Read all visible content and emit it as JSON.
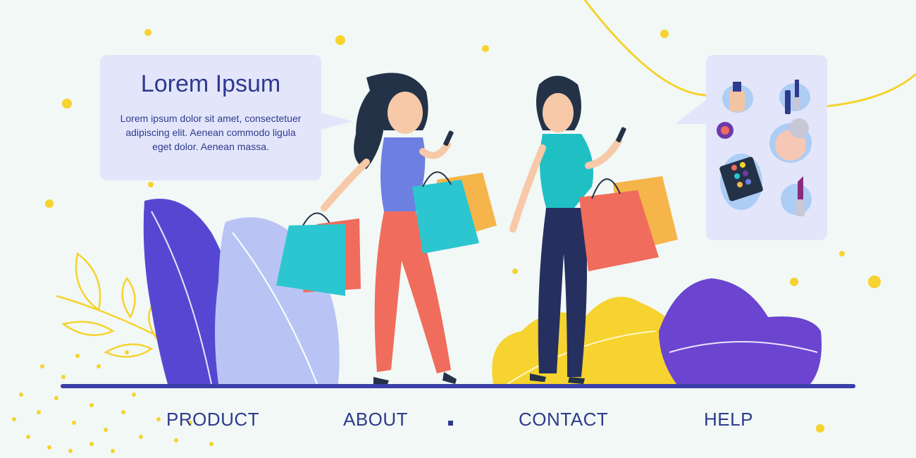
{
  "hero": {
    "title": "Lorem Ipsum",
    "body": "Lorem ipsum dolor sit amet, consectetuer adipiscing elit. Aenean commodo ligula eget dolor. Aenean massa."
  },
  "nav": {
    "items": [
      {
        "label": "PRODUCT"
      },
      {
        "label": "ABOUT"
      },
      {
        "label": "CONTACT"
      },
      {
        "label": "HELP"
      }
    ]
  },
  "colors": {
    "background": "#f1f8f6",
    "accent_navy": "#2e3a8c",
    "panel": "#e3e6fb",
    "yellow": "#f6d32e",
    "purple": "#5b3fcf",
    "teal_bag": "#2bc6d0",
    "coral_bag": "#f06c5c"
  },
  "illustration": {
    "subjects": [
      "woman-shopper-left-icon",
      "woman-shopper-right-icon"
    ],
    "cosmetics": [
      "foundation-bottle-icon",
      "mascara-icon",
      "eyeshadow-icon",
      "compact-powder-icon",
      "eyeshadow-palette-icon",
      "lipstick-icon"
    ]
  }
}
